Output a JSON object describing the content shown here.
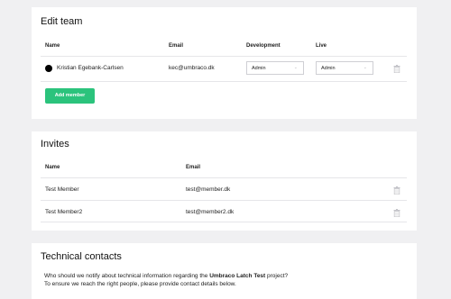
{
  "edit_team": {
    "title": "Edit team",
    "columns": {
      "name": "Name",
      "email": "Email",
      "development": "Development",
      "live": "Live"
    },
    "members": [
      {
        "name": "Kristian Egebank-Carlsen",
        "email": "kec@umbraco.dk",
        "development": "Admin",
        "live": "Admin"
      }
    ],
    "add_member_label": "Add member",
    "accent_color": "#2bc37c"
  },
  "invites": {
    "title": "Invites",
    "columns": {
      "name": "Name",
      "email": "Email"
    },
    "rows": [
      {
        "name": "Test Member",
        "email": "test@member.dk"
      },
      {
        "name": "Test Member2",
        "email": "test@member2.dk"
      }
    ]
  },
  "technical_contacts": {
    "title": "Technical contacts",
    "line1_prefix": "Who should we notify about technical information regarding the ",
    "line1_project": "Umbraco Latch Test",
    "line1_suffix": " project?",
    "line2": "To ensure we reach the right people, please provide contact details below."
  }
}
